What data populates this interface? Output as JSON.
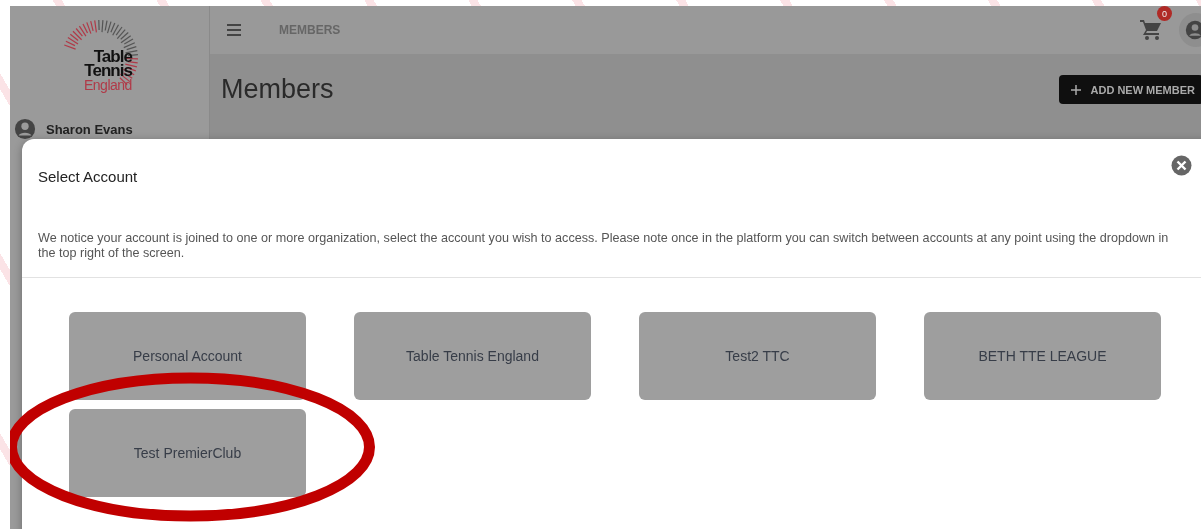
{
  "sidebar": {
    "logo": {
      "lines": [
        "Table",
        "Tennis",
        "England"
      ]
    },
    "user": {
      "name": "Sharon Evans"
    }
  },
  "header": {
    "page_label": "MEMBERS",
    "cart_count": "0"
  },
  "page": {
    "title": "Members",
    "add_button": "ADD NEW MEMBER"
  },
  "dialog": {
    "title": "Select Account",
    "message": "We notice your account is joined to one or more organization, select the account you wish to access. Please note once in the platform you can switch between accounts at any point using the dropdown in the top right of the screen.",
    "accounts": [
      {
        "label": "Personal Account",
        "highlighted": false
      },
      {
        "label": "Table Tennis England",
        "highlighted": false
      },
      {
        "label": "Test2 TTC",
        "highlighted": false
      },
      {
        "label": "BETH TTE LEAGUE",
        "highlighted": false
      },
      {
        "label": "Test PremierClub",
        "highlighted": true
      }
    ]
  }
}
